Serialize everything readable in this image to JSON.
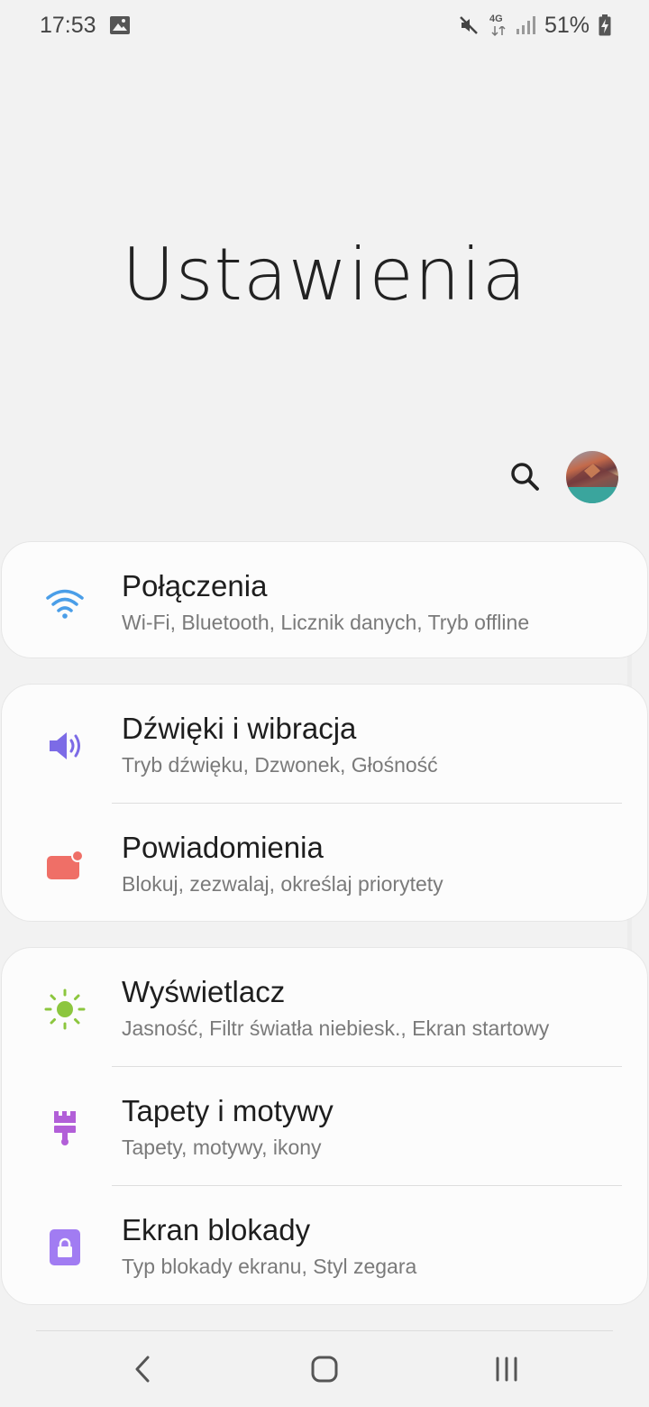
{
  "status_bar": {
    "time": "17:53",
    "battery": "51%",
    "network": "4G",
    "icons": [
      "image-icon",
      "mute-icon",
      "network-4g-icon",
      "signal-icon",
      "battery-charging-icon"
    ]
  },
  "title": "Ustawienia",
  "actions": {
    "search_icon": "search-icon",
    "avatar": "profile-avatar"
  },
  "groups": [
    {
      "items": [
        {
          "title": "Połączenia",
          "subtitle": "Wi-Fi, Bluetooth, Licznik danych, Tryb offline",
          "icon": "wifi-icon",
          "color": "#4a9ee8"
        }
      ]
    },
    {
      "items": [
        {
          "title": "Dźwięki i wibracja",
          "subtitle": "Tryb dźwięku, Dzwonek, Głośność",
          "icon": "speaker-icon",
          "color": "#7c6be6"
        },
        {
          "title": "Powiadomienia",
          "subtitle": "Blokuj, zezwalaj, określaj priorytety",
          "icon": "notification-icon",
          "color": "#ef6f67"
        }
      ]
    },
    {
      "items": [
        {
          "title": "Wyświetlacz",
          "subtitle": "Jasność, Filtr światła niebiesk., Ekran startowy",
          "icon": "brightness-icon",
          "color": "#8cc63e"
        },
        {
          "title": "Tapety i motywy",
          "subtitle": "Tapety, motywy, ikony",
          "icon": "paintbrush-icon",
          "color": "#b25fd8"
        },
        {
          "title": "Ekran blokady",
          "subtitle": "Typ blokady ekranu, Styl zegara",
          "icon": "lock-icon",
          "color": "#a17cf2"
        }
      ]
    }
  ],
  "nav": {
    "back_icon": "back-icon",
    "home_icon": "home-icon",
    "recents_icon": "recents-icon"
  }
}
